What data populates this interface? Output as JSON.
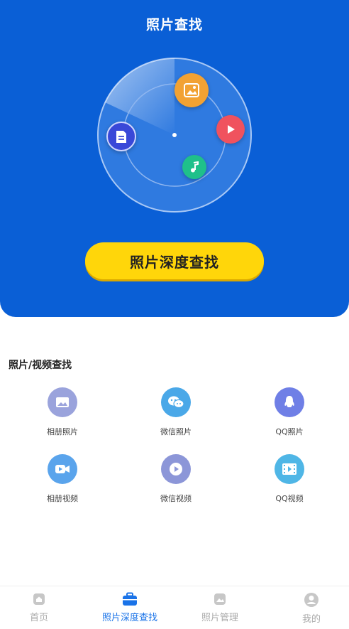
{
  "header": {
    "title": "照片查找"
  },
  "hero": {
    "deep_search_button": "照片深度查找",
    "scan_items": [
      "image-icon",
      "video-play-icon",
      "music-note-icon",
      "document-icon"
    ]
  },
  "section": {
    "title": "照片/视频查找",
    "items": [
      {
        "label": "相册照片",
        "icon": "album-photo-icon",
        "color": "#9aa3dc"
      },
      {
        "label": "微信照片",
        "icon": "wechat-icon",
        "color": "#4aa8e8"
      },
      {
        "label": "QQ照片",
        "icon": "qq-icon",
        "color": "#6f7fe6"
      },
      {
        "label": "相册视频",
        "icon": "album-video-icon",
        "color": "#5aa4ec"
      },
      {
        "label": "微信视频",
        "icon": "wechat-video-icon",
        "color": "#8c96d8"
      },
      {
        "label": "QQ视频",
        "icon": "qq-video-icon",
        "color": "#4fb6e6"
      }
    ]
  },
  "tabs": [
    {
      "label": "首页",
      "icon": "home-icon",
      "active": false
    },
    {
      "label": "照片深度查找",
      "icon": "briefcase-icon",
      "active": true
    },
    {
      "label": "照片管理",
      "icon": "photo-manage-icon",
      "active": false
    },
    {
      "label": "我的",
      "icon": "user-icon",
      "active": false
    }
  ],
  "colors": {
    "primary": "#0a5fd6",
    "accent": "#ffd60a",
    "active_tab": "#1a73e8"
  }
}
